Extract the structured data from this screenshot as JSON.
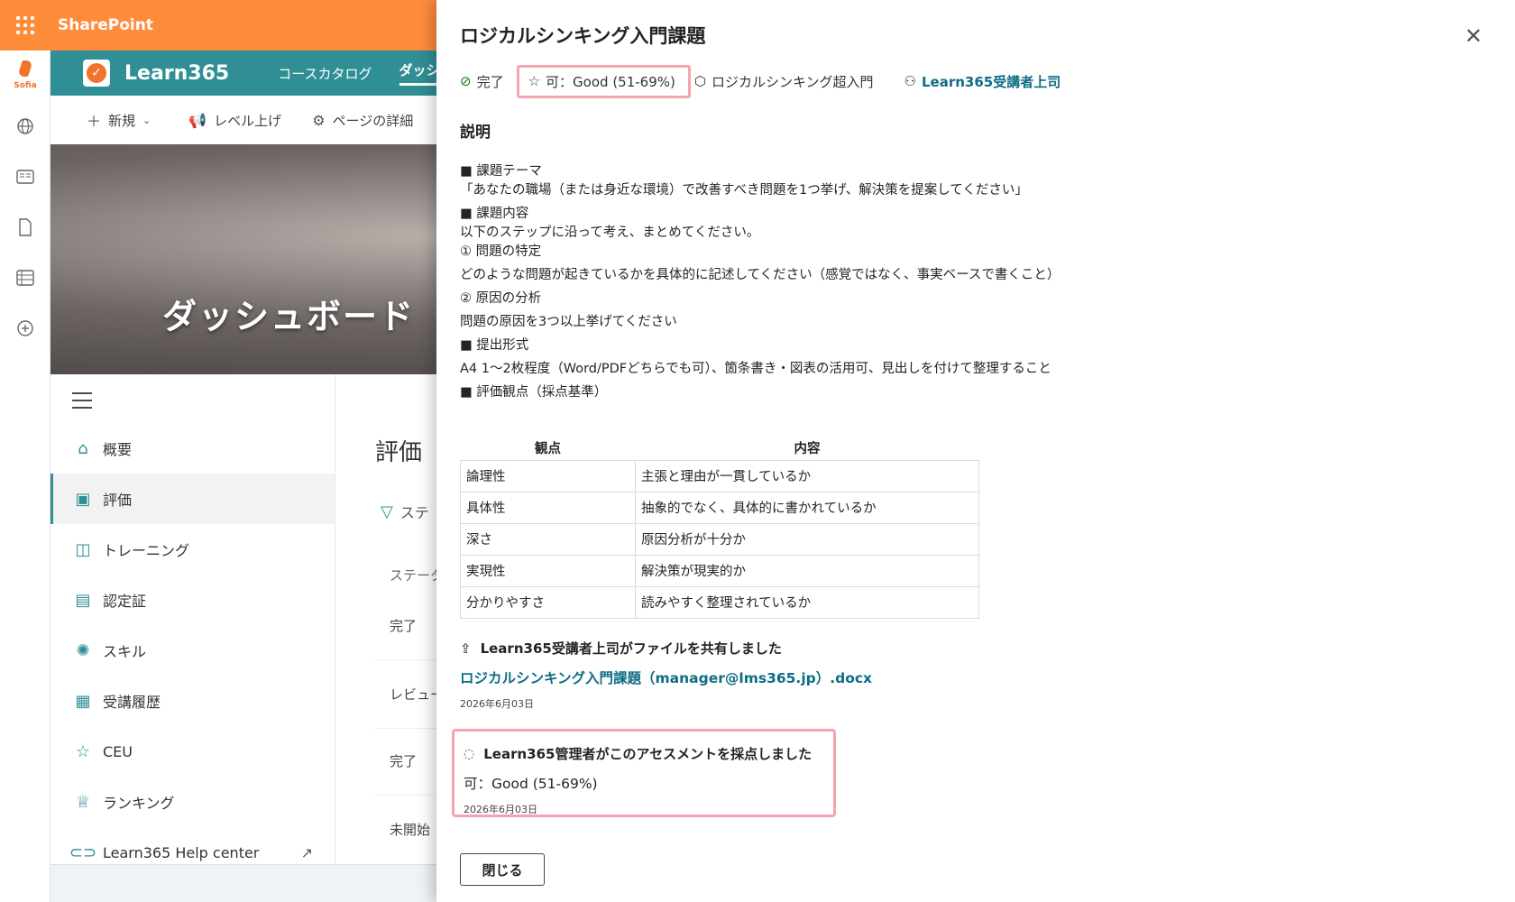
{
  "suitebar": {
    "title": "SharePoint"
  },
  "rail": {
    "logo_text": "Sofia"
  },
  "hub": {
    "title": "Learn365",
    "links": [
      "コースカタログ",
      "ダッシュ"
    ]
  },
  "commands": {
    "new": "新規",
    "level_up": "レベル上げ",
    "page_details": "ページの詳細"
  },
  "hero": {
    "title": "ダッシュボード"
  },
  "leftnav": {
    "items": [
      {
        "label": "概要",
        "icon": "home-icon"
      },
      {
        "label": "評価",
        "icon": "assessment-icon"
      },
      {
        "label": "トレーニング",
        "icon": "book-icon"
      },
      {
        "label": "認定証",
        "icon": "certificate-icon"
      },
      {
        "label": "スキル",
        "icon": "skill-badge-icon"
      },
      {
        "label": "受講履歴",
        "icon": "history-document-icon"
      },
      {
        "label": "CEU",
        "icon": "star-list-icon"
      },
      {
        "label": "ランキング",
        "icon": "trophy-icon"
      },
      {
        "label": "Learn365 Help center",
        "icon": "link-icon"
      }
    ]
  },
  "main": {
    "title": "評価",
    "filter_label": "ステ",
    "column_header": "ステータ",
    "rows": [
      "完了",
      "レビュー",
      "完了",
      "未開始"
    ]
  },
  "panel": {
    "title": "ロジカルシンキング入門課題",
    "status": "完了",
    "grade": "可：Good (51-69%)",
    "course": "ロジカルシンキング超入門",
    "manager": "Learn365受講者上司",
    "section_heading": "説明",
    "description": [
      "■ 課題テーマ",
      "「あなたの職場（または身近な環境）で改善すべき問題を1つ挙げ、解決策を提案してください」",
      "■ 課題内容",
      "以下のステップに沿って考え、まとめてください。",
      "① 問題の特定",
      "どのような問題が起きているかを具体的に記述してください（感覚ではなく、事実ベースで書くこと）",
      "② 原因の分析",
      "問題の原因を3つ以上挙げてください",
      "■ 提出形式",
      "A4 1〜2枚程度（Word/PDFどちらでも可）、箇条書き・図表の活用可、見出しを付けて整理すること",
      "■ 評価観点（採点基準）"
    ],
    "table": {
      "headers": [
        "観点",
        "内容"
      ],
      "rows": [
        [
          "論理性",
          "主張と理由が一貫しているか"
        ],
        [
          "具体性",
          "抽象的でなく、具体的に書かれているか"
        ],
        [
          "深さ",
          "原因分析が十分か"
        ],
        [
          "実現性",
          "解決策が現実的か"
        ],
        [
          "分かりやすさ",
          "読みやすく整理されているか"
        ]
      ]
    },
    "share_text": "Learn365受講者上司がファイルを共有しました",
    "file_name": "ロジカルシンキング入門課題（manager@lms365.jp）.docx",
    "share_date": "2026年6月03日",
    "graded_text": "Learn365管理者がこのアセスメントを採点しました",
    "graded_grade": "可：Good (51-69%)",
    "graded_date": "2026年6月03日",
    "close_button": "閉じる"
  },
  "colors": {
    "accent_orange": "#ff8c3b",
    "teal": "#2f8f94",
    "link": "#0f6c84",
    "highlight": "#f4a5b0"
  }
}
